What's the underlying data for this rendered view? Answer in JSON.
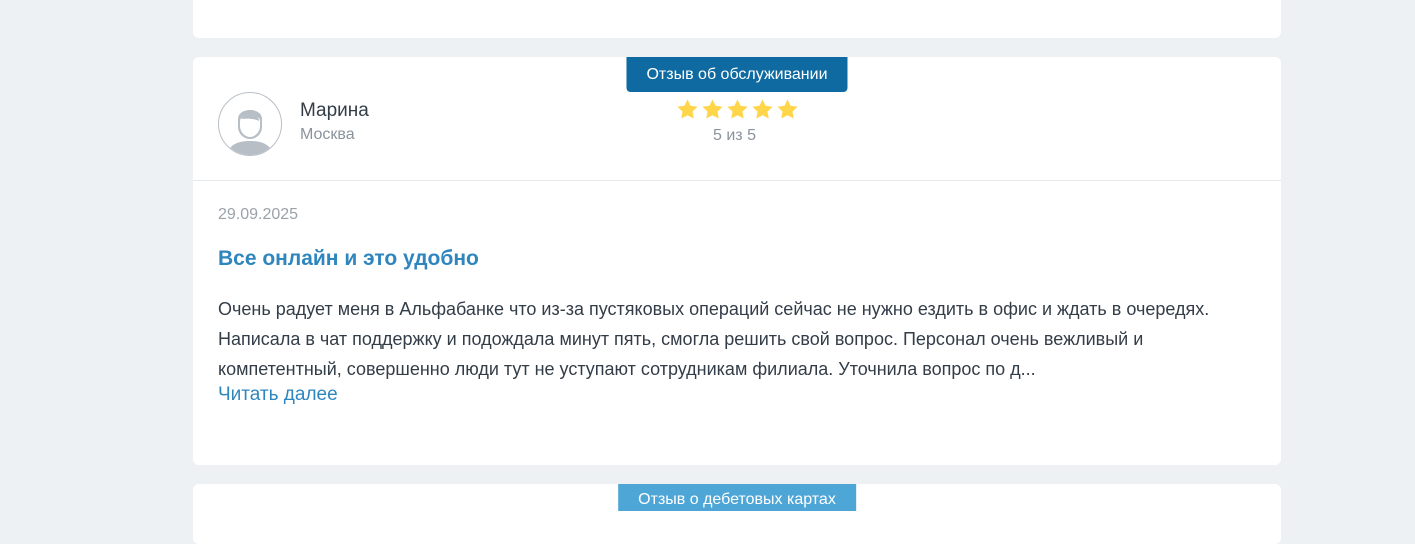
{
  "review": {
    "badge_label": "Отзыв об обслуживании",
    "badge_color": "#0e6aa0",
    "author_name": "Марина",
    "author_city": "Москва",
    "rating_value": 5,
    "rating_max": 5,
    "rating_text": "5 из 5",
    "star_color": "#ffd54a",
    "date": "29.09.2025",
    "title": "Все онлайн и это удобно",
    "text": "Очень радует меня в Альфабанке что из-за пустяковых операций сейчас не нужно ездить в офис и ждать в очередях. Написала в чат поддержку и подождала минут пять, смогла решить свой вопрос. Персонал очень вежливый и компетентный, совершенно люди тут не уступают сотрудникам филиала. Уточнила вопрос по д...",
    "read_more_label": "Читать далее"
  },
  "next_review": {
    "badge_label": "Отзыв о дебетовых картах",
    "badge_color": "#4ea6d6"
  }
}
